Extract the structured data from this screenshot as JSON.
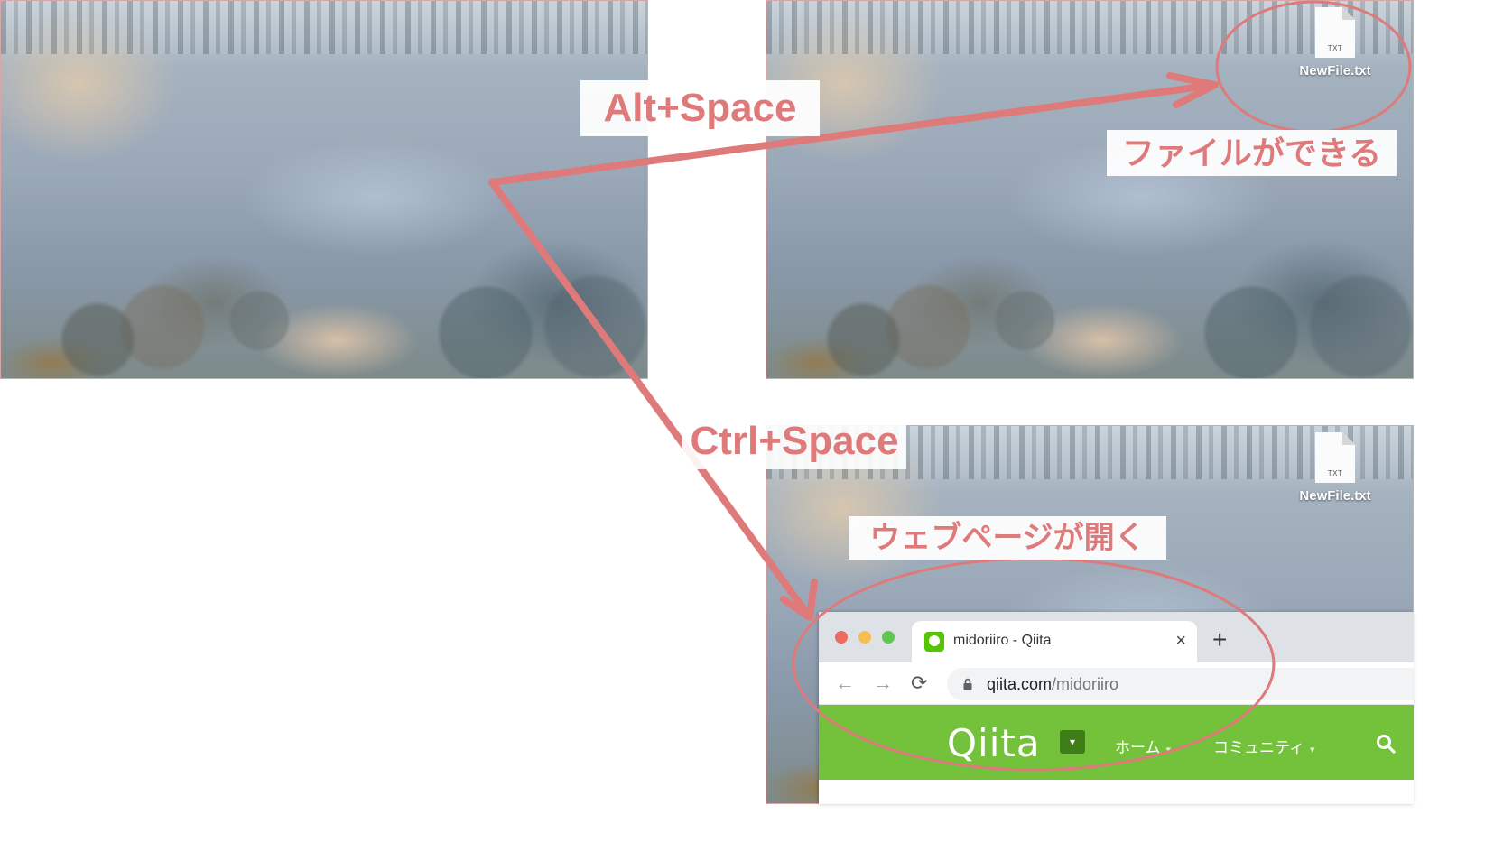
{
  "shortcuts": {
    "alt": "Alt+Space",
    "ctrl": "Ctrl+Space"
  },
  "results": {
    "file_created": "ファイルができる",
    "web_opens": "ウェブページが開く"
  },
  "desktop_file": {
    "name": "NewFile.txt",
    "ext": "TXT",
    "icon": "text-file-icon"
  },
  "browser": {
    "tab_title": "midoriiro - Qiita",
    "tab_close": "×",
    "new_tab": "+",
    "url_host": "qiita.com",
    "url_path": "/midoriiro",
    "nav": {
      "back": "←",
      "forward": "→",
      "reload": "⟳"
    }
  },
  "qiita": {
    "logo": "Qiita",
    "dropdown": "▾",
    "nav": [
      {
        "label": "ホーム",
        "caret": "▾"
      },
      {
        "label": "コミュニティ",
        "caret": "▾"
      }
    ],
    "brand_color": "#74c23b"
  },
  "colors": {
    "annotation": "#df7a7b",
    "traffic_close": "#ed6a5e",
    "traffic_min": "#f5bf4f",
    "traffic_max": "#61c554"
  }
}
